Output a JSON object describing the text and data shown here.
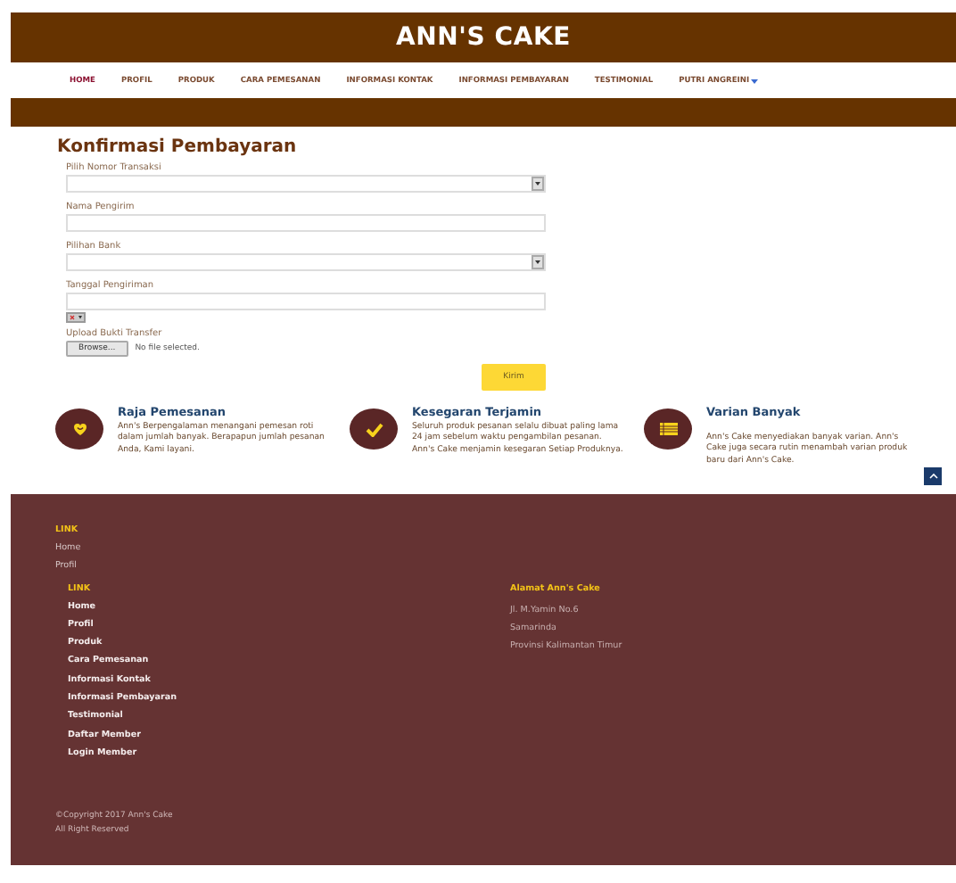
{
  "header": {
    "title": "ANN'S CAKE"
  },
  "nav": [
    {
      "label": "HOME",
      "selected": true,
      "has_menu": false
    },
    {
      "label": "PROFIL",
      "selected": false,
      "has_menu": false
    },
    {
      "label": "PRODUK",
      "selected": false,
      "has_menu": false
    },
    {
      "label": "CARA PEMESANAN",
      "selected": false,
      "has_menu": false
    },
    {
      "label": "INFORMASI KONTAK",
      "selected": false,
      "has_menu": false
    },
    {
      "label": "INFORMASI PEMBAYARAN",
      "selected": false,
      "has_menu": false
    },
    {
      "label": "TESTIMONIAL",
      "selected": false,
      "has_menu": false
    },
    {
      "label": "PUTRI ANGREINI",
      "selected": false,
      "has_menu": true
    }
  ],
  "form": {
    "title": "Konfirmasi Pembayaran",
    "fields": [
      {
        "kind": "select",
        "label": "Pilih Nomor Transaksi"
      },
      {
        "kind": "text",
        "label": "Nama Pengirim"
      },
      {
        "kind": "select",
        "label": "Pilihan Bank"
      },
      {
        "kind": "date",
        "label": "Tanggal Pengiriman"
      },
      {
        "kind": "file",
        "label": "Upload Bukti Transfer",
        "button": "Browse...",
        "status": "No file selected."
      }
    ],
    "submit": "Kirim"
  },
  "features": [
    {
      "kind": "heart",
      "title": "Raja Pemesanan",
      "text": "Ann's Berpengalaman menangani pemesan roti dalam jumlah banyak. Berapapun jumlah pesanan Anda, Kami layani."
    },
    {
      "kind": "check",
      "title": "Kesegaran Terjamin",
      "text": "Seluruh produk pesanan selalu dibuat paling lama 24 jam sebelum waktu pengambilan pesanan. Ann's Cake menjamin kesegaran Setiap Produknya."
    },
    {
      "kind": "list",
      "title": "Varian Banyak",
      "text": "Ann's Cake menyediakan banyak varian. Ann's Cake juga secara rutin menambah varian produk baru dari Ann's Cake."
    }
  ],
  "footer": {
    "heading": "LINK",
    "links": [
      "Home",
      "Profil"
    ],
    "columns": [
      {
        "kind": "links",
        "heading": "LINK",
        "items": [
          "Home",
          "Profil",
          "Produk",
          "Cara Pemesanan",
          "Informasi Kontak",
          "Informasi Pembayaran",
          "Testimonial",
          "Daftar Member",
          "Login Member"
        ]
      },
      {
        "kind": "address",
        "heading": "Alamat Ann's Cake",
        "items": [
          "Jl. M.Yamin No.6",
          "Samarinda",
          "Provinsi Kalimantan Timur"
        ]
      }
    ],
    "copyright": [
      "©Copyright 2017 Ann's Cake",
      "All Right Reserved"
    ]
  }
}
